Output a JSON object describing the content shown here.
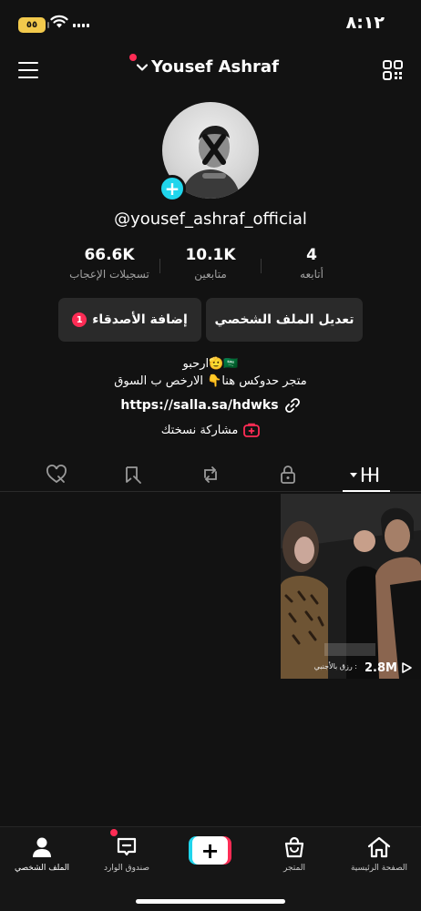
{
  "status_bar": {
    "time": "٨:١٢",
    "battery": "٥٥"
  },
  "header": {
    "account_name": "Yousef Ashraf"
  },
  "profile": {
    "username": "@yousef_ashraf_official"
  },
  "stats": [
    {
      "value": "66.6K",
      "label": "تسجيلات الإعجاب"
    },
    {
      "value": "10.1K",
      "label": "متابعين"
    },
    {
      "value": "4",
      "label": "أتابعه"
    }
  ],
  "buttons": {
    "edit_profile": "تعديل الملف الشخصي",
    "add_friends": "إضافة الأصدقاء",
    "add_friends_badge": "1"
  },
  "bio": {
    "line1": "ارحبو🫡🇸🇦",
    "line2": "متجر حدوكس هنا👇 الارخص ب السوق"
  },
  "link": "https://salla.sa/hdwks",
  "share": "مشاركة نسختك",
  "video": {
    "views": "2.8M",
    "caption": "رزق بالأجنبي :"
  },
  "bottom_nav": {
    "home": "الصفحة الرئيسية",
    "shop": "المتجر",
    "inbox": "صندوق الوارد",
    "profile": "الملف الشخصي"
  },
  "colors": {
    "background": "#121212",
    "accent": "#fe2c55",
    "cyan": "#20d5ec"
  }
}
